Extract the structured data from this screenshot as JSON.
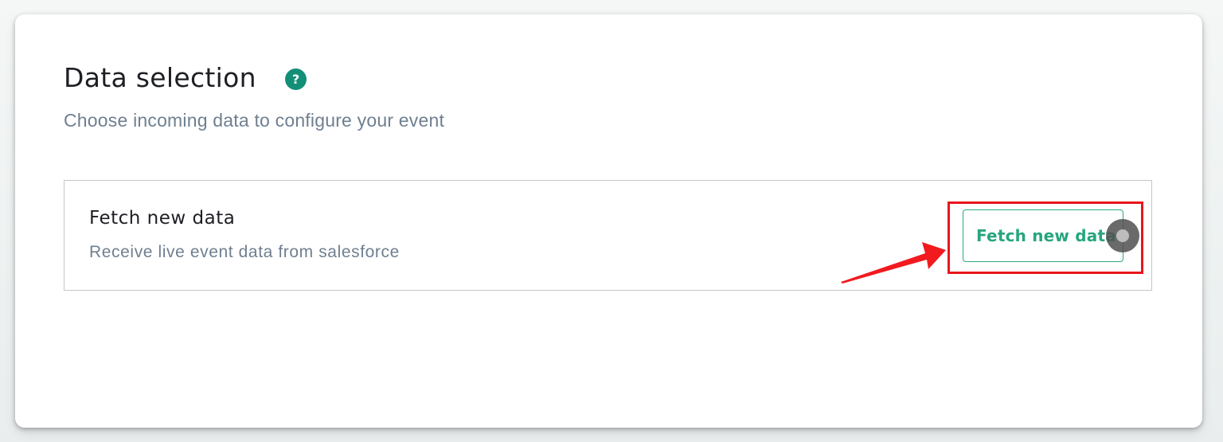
{
  "header": {
    "title": "Data selection",
    "subtitle": "Choose incoming data to configure your event",
    "help_icon_glyph": "?"
  },
  "fetch_panel": {
    "title": "Fetch new data",
    "description": "Receive live event data from salesforce",
    "button_label": "Fetch new data"
  },
  "icons": {
    "help": "help-question-icon",
    "annotation_arrow": "arrow-right-icon",
    "cursor": "cursor-indicator-icon"
  },
  "colors": {
    "accent_green": "#27a57f",
    "help_icon_bg": "#138f77",
    "annotation_red": "#e8161b",
    "muted_text": "#6f7f90",
    "title_text": "#1d1f24"
  }
}
